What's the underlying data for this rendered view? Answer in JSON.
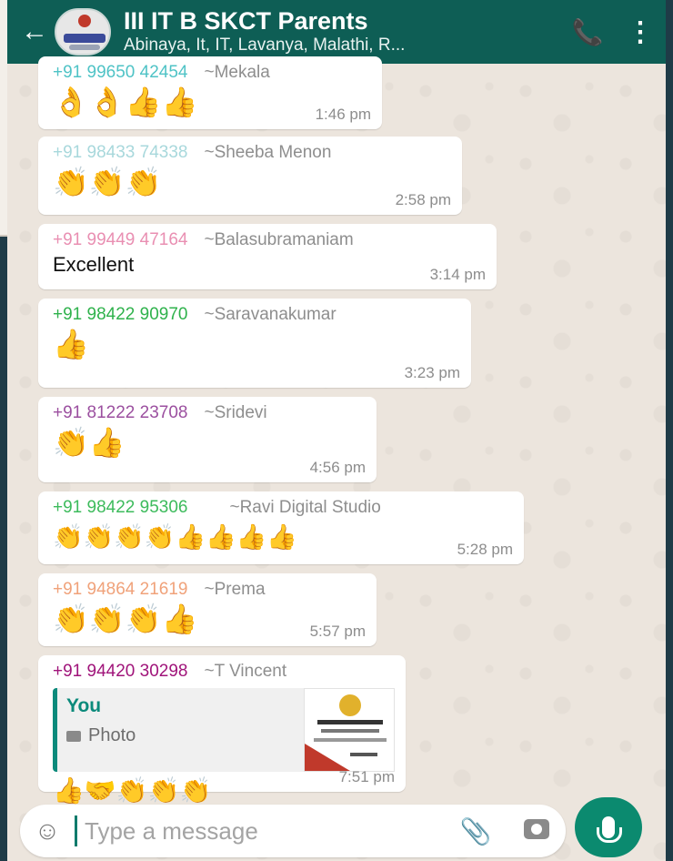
{
  "header": {
    "back_icon": "←",
    "title": "III IT B SKCT Parents",
    "members": "Abinaya, It, IT, Lavanya, Malathi, R...",
    "call_icon": "📞",
    "menu_icon": "⋮"
  },
  "messages": [
    {
      "phone": "+91 99650 42454",
      "nick": "~Mekala",
      "body": "👌👌👍👍",
      "time": "1:46 pm",
      "color": "#4fc3c6"
    },
    {
      "phone": "+91 98433 74338",
      "nick": "~Sheeba Menon",
      "body": "👏👏👏",
      "time": "2:58 pm",
      "color": "#a8d8dc"
    },
    {
      "phone": "+91 99449 47164",
      "nick": "~Balasubramaniam",
      "body": "Excellent",
      "time": "3:14 pm",
      "color": "#e98fb2"
    },
    {
      "phone": "+91 98422 90970",
      "nick": "~Saravanakumar",
      "body": "👍",
      "time": "3:23 pm",
      "color": "#2fb24c"
    },
    {
      "phone": "+91 81222 23708",
      "nick": "~Sridevi",
      "body": "👏👍",
      "time": "4:56 pm",
      "color": "#9b4f9f"
    },
    {
      "phone": "+91 98422 95306",
      "nick": "~Ravi Digital Studio",
      "body": "👏👏👏👏👍👍👍👍",
      "time": "5:28 pm",
      "color": "#3dbb5c"
    },
    {
      "phone": "+91 94864 21619",
      "nick": "~Prema",
      "body": "👏👏👏👍",
      "time": "5:57 pm",
      "color": "#f0a27a"
    },
    {
      "phone": "+91 94420 30298",
      "nick": "~T Vincent",
      "body": "👍🤝👏👏👏",
      "time": "7:51 pm",
      "color": "#a0147a",
      "quote": {
        "author": "You",
        "kind": "Photo"
      }
    }
  ],
  "composer": {
    "placeholder": "Type a message",
    "emoji_icon": "☺",
    "attach_icon": "📎"
  }
}
